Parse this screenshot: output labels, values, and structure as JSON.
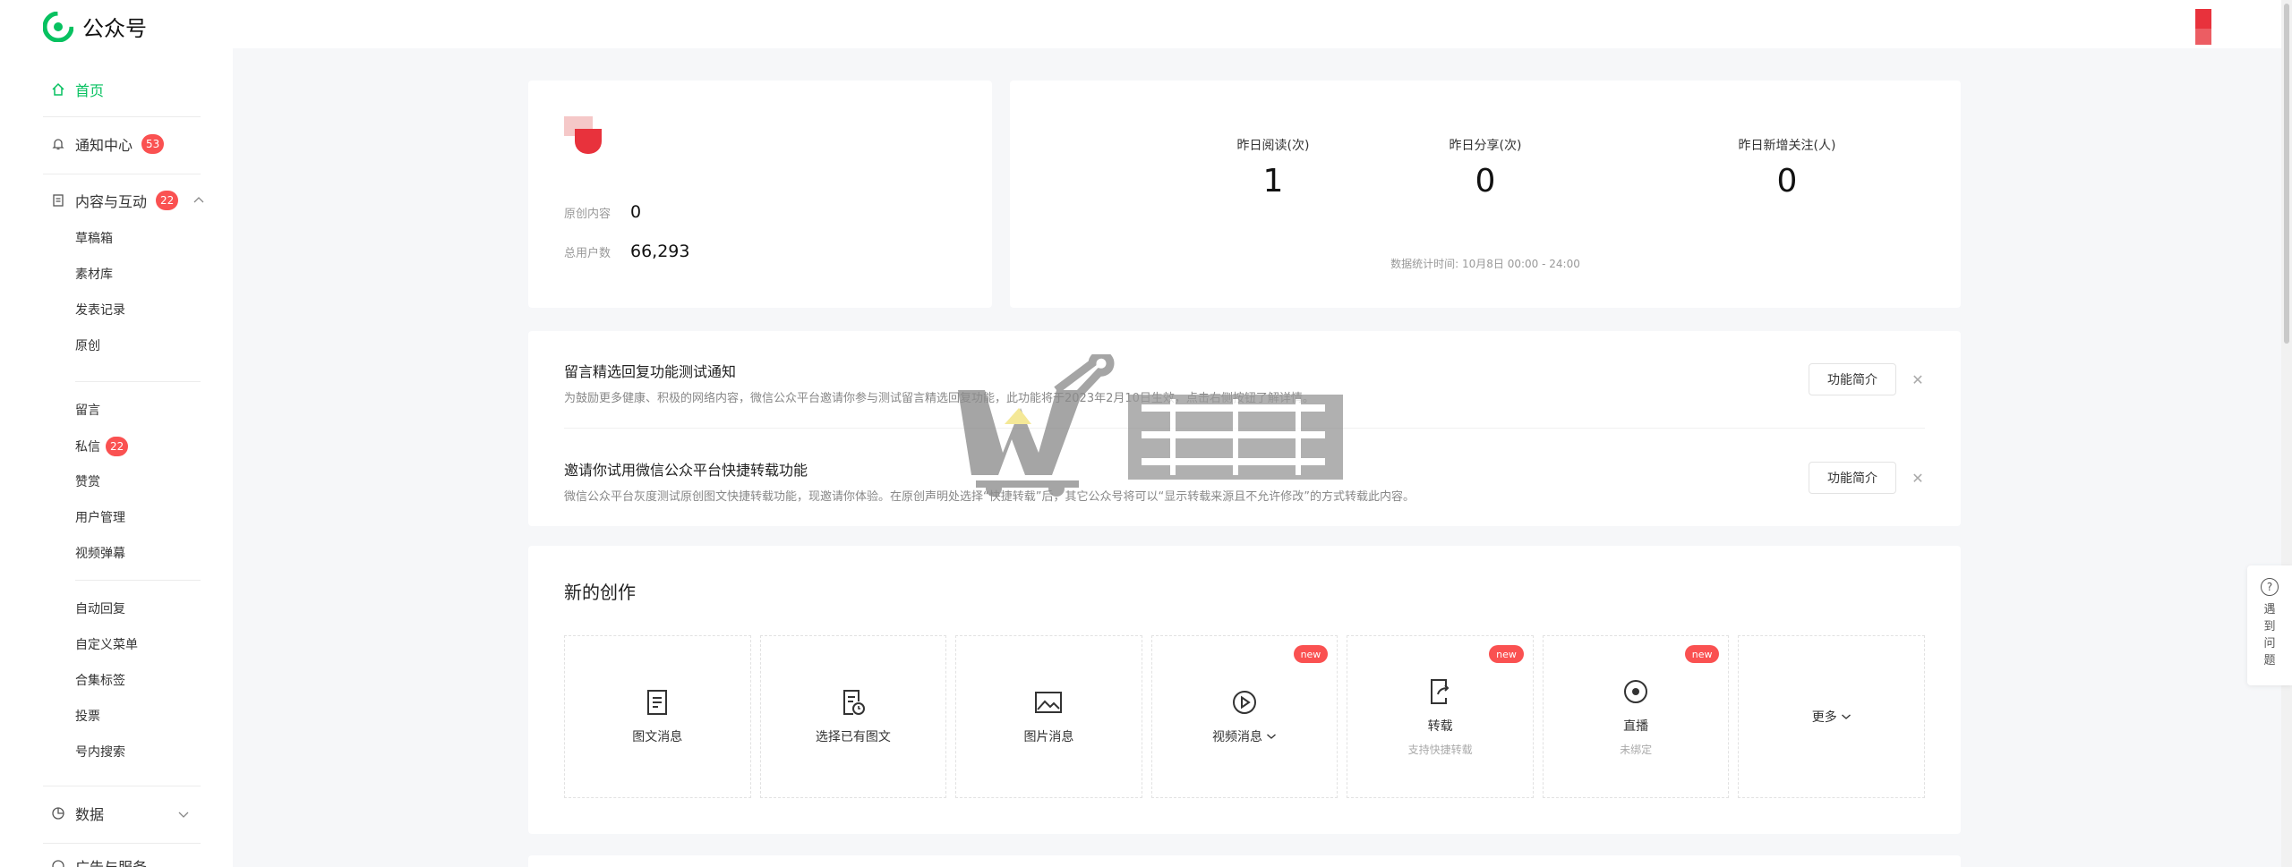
{
  "app": {
    "title": "公众号"
  },
  "sidebar": {
    "home": "首页",
    "notifications": {
      "label": "通知中心",
      "badge": "53"
    },
    "content": {
      "label": "内容与互动",
      "badge": "22"
    },
    "content_items_a": [
      "草稿箱",
      "素材库",
      "发表记录",
      "原创"
    ],
    "content_items_b": [
      {
        "label": "留言"
      },
      {
        "label": "私信",
        "badge": "22"
      },
      {
        "label": "赞赏"
      },
      {
        "label": "用户管理"
      },
      {
        "label": "视频弹幕"
      }
    ],
    "content_items_c": [
      "自动回复",
      "自定义菜单",
      "合集标签",
      "投票",
      "号内搜索"
    ],
    "data": {
      "label": "数据"
    },
    "next_section": {
      "label": "广告与服务"
    }
  },
  "profile": {
    "original_label": "原创内容",
    "original_value": "0",
    "users_label": "总用户数",
    "users_value": "66,293"
  },
  "stats": {
    "items": [
      {
        "label": "昨日阅读(次)",
        "value": "1"
      },
      {
        "label": "昨日分享(次)",
        "value": "0"
      },
      {
        "label": "昨日新增关注(人)",
        "value": "0"
      }
    ],
    "note": "数据统计时间: 10月8日 00:00 - 24:00"
  },
  "notices": [
    {
      "title": "留言精选回复功能测试通知",
      "desc": "为鼓励更多健康、积极的网络内容，微信公众平台邀请你参与测试留言精选回复功能，此功能将于2023年2月10日生效，点击右侧按钮了解详情。",
      "button": "功能简介"
    },
    {
      "title": "邀请你试用微信公众平台快捷转载功能",
      "desc": "微信公众平台灰度测试原创图文快捷转载功能，现邀请你体验。在原创声明处选择“快捷转载”后，其它公众号将可以“显示转载来源且不允许修改”的方式转载此内容。",
      "button": "功能简介"
    }
  ],
  "create": {
    "title": "新的创作",
    "tiles": [
      {
        "label": "图文消息",
        "icon": "doc-icon"
      },
      {
        "label": "选择已有图文",
        "icon": "doc-clock-icon"
      },
      {
        "label": "图片消息",
        "icon": "image-icon"
      },
      {
        "label": "视频消息",
        "icon": "play-icon",
        "badge": "new",
        "has_dropdown": true
      },
      {
        "label": "转载",
        "sub": "支持快捷转载",
        "icon": "share-doc-icon",
        "badge": "new"
      },
      {
        "label": "直播",
        "sub": "未绑定",
        "icon": "live-icon",
        "badge": "new"
      },
      {
        "label": "更多",
        "icon": "",
        "has_dropdown": true
      }
    ]
  },
  "help": {
    "label": "遇到问题"
  },
  "colors": {
    "accent": "#07c160",
    "badge": "#fa5151"
  }
}
